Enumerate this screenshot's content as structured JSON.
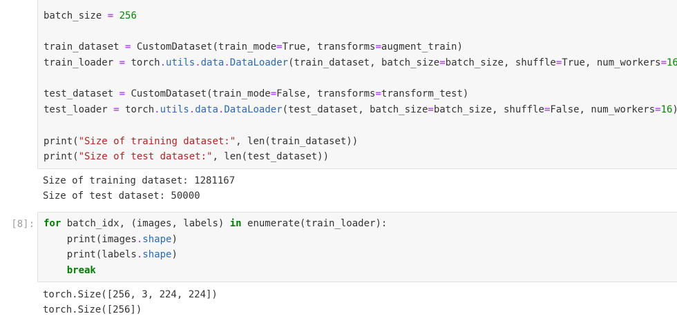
{
  "cell_top": {
    "lines": [
      [
        {
          "t": "batch_size ",
          "c": ""
        },
        {
          "t": "=",
          "c": "eqop"
        },
        {
          "t": " ",
          "c": ""
        },
        {
          "t": "256",
          "c": "num"
        }
      ],
      [],
      [
        {
          "t": "train_dataset ",
          "c": ""
        },
        {
          "t": "=",
          "c": "eqop"
        },
        {
          "t": " CustomDataset(train_mode",
          "c": ""
        },
        {
          "t": "=",
          "c": "eqop"
        },
        {
          "t": "True, transforms",
          "c": ""
        },
        {
          "t": "=",
          "c": "eqop"
        },
        {
          "t": "augment_train)",
          "c": ""
        }
      ],
      [
        {
          "t": "train_loader ",
          "c": ""
        },
        {
          "t": "=",
          "c": "eqop"
        },
        {
          "t": " torch",
          "c": ""
        },
        {
          "t": ".",
          "c": "eqop"
        },
        {
          "t": "utils",
          "c": "attr"
        },
        {
          "t": ".",
          "c": "eqop"
        },
        {
          "t": "data",
          "c": "attr"
        },
        {
          "t": ".",
          "c": "eqop"
        },
        {
          "t": "DataLoader",
          "c": "attr"
        },
        {
          "t": "(train_dataset, batch_size",
          "c": ""
        },
        {
          "t": "=",
          "c": "eqop"
        },
        {
          "t": "batch_size, shuffle",
          "c": ""
        },
        {
          "t": "=",
          "c": "eqop"
        },
        {
          "t": "True, num_workers",
          "c": ""
        },
        {
          "t": "=",
          "c": "eqop"
        },
        {
          "t": "16",
          "c": "num"
        },
        {
          "t": ")",
          "c": ""
        }
      ],
      [],
      [
        {
          "t": "test_dataset ",
          "c": ""
        },
        {
          "t": "=",
          "c": "eqop"
        },
        {
          "t": " CustomDataset(train_mode",
          "c": ""
        },
        {
          "t": "=",
          "c": "eqop"
        },
        {
          "t": "False, transforms",
          "c": ""
        },
        {
          "t": "=",
          "c": "eqop"
        },
        {
          "t": "transform_test)",
          "c": ""
        }
      ],
      [
        {
          "t": "test_loader ",
          "c": ""
        },
        {
          "t": "=",
          "c": "eqop"
        },
        {
          "t": " torch",
          "c": ""
        },
        {
          "t": ".",
          "c": "eqop"
        },
        {
          "t": "utils",
          "c": "attr"
        },
        {
          "t": ".",
          "c": "eqop"
        },
        {
          "t": "data",
          "c": "attr"
        },
        {
          "t": ".",
          "c": "eqop"
        },
        {
          "t": "DataLoader",
          "c": "attr"
        },
        {
          "t": "(test_dataset, batch_size",
          "c": ""
        },
        {
          "t": "=",
          "c": "eqop"
        },
        {
          "t": "batch_size, shuffle",
          "c": ""
        },
        {
          "t": "=",
          "c": "eqop"
        },
        {
          "t": "False, num_workers",
          "c": ""
        },
        {
          "t": "=",
          "c": "eqop"
        },
        {
          "t": "16",
          "c": "num"
        },
        {
          "t": ")",
          "c": ""
        }
      ],
      [],
      [
        {
          "t": "print(",
          "c": ""
        },
        {
          "t": "\"Size of training dataset:\"",
          "c": "str"
        },
        {
          "t": ", len(train_dataset))",
          "c": ""
        }
      ],
      [
        {
          "t": "print(",
          "c": ""
        },
        {
          "t": "\"Size of test dataset:\"",
          "c": "str"
        },
        {
          "t": ", len(test_dataset))",
          "c": ""
        }
      ]
    ],
    "output": [
      "Size of training dataset: 1281167",
      "Size of test dataset: 50000"
    ]
  },
  "cell_8": {
    "prompt": "[8]:",
    "lines": [
      [
        {
          "t": "for",
          "c": "kw"
        },
        {
          "t": " batch_idx, (images, labels) ",
          "c": ""
        },
        {
          "t": "in",
          "c": "kw"
        },
        {
          "t": " enumerate(train_loader):",
          "c": ""
        }
      ],
      [
        {
          "t": "    print(images",
          "c": ""
        },
        {
          "t": ".",
          "c": "eqop"
        },
        {
          "t": "shape",
          "c": "attr"
        },
        {
          "t": ")",
          "c": ""
        }
      ],
      [
        {
          "t": "    print(labels",
          "c": ""
        },
        {
          "t": ".",
          "c": "eqop"
        },
        {
          "t": "shape",
          "c": "attr"
        },
        {
          "t": ")",
          "c": ""
        }
      ],
      [
        {
          "t": "    ",
          "c": ""
        },
        {
          "t": "break",
          "c": "kw"
        }
      ]
    ],
    "output": [
      "torch.Size([256, 3, 224, 224])",
      "torch.Size([256])"
    ]
  }
}
